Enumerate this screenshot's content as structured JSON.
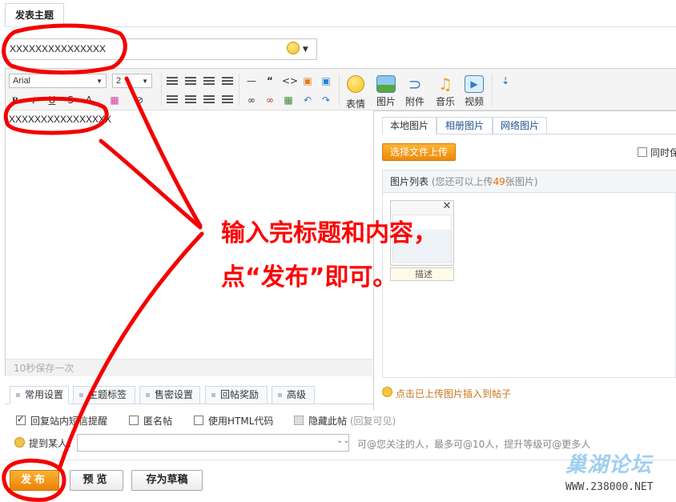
{
  "header": {
    "tab_label": "发表主题"
  },
  "subject": {
    "value": "XXXXXXXXXXXXXXX"
  },
  "toolbar": {
    "font": "Arial",
    "size": "2",
    "big_tools": [
      {
        "label": "表情",
        "icon": "smiley-icon"
      },
      {
        "label": "图片",
        "icon": "image-icon"
      },
      {
        "label": "附件",
        "icon": "paperclip-icon"
      },
      {
        "label": "音乐",
        "icon": "music-icon"
      },
      {
        "label": "视频",
        "icon": "video-icon"
      }
    ]
  },
  "editor": {
    "body": "XXXXXXXXXXXXXXXX",
    "autosave": "10秒保存一次"
  },
  "image_panel": {
    "tabs": [
      "本地图片",
      "相册图片",
      "网络图片"
    ],
    "upload_button": "选择文件上传",
    "same_label": "同时保",
    "list_title": "图片列表",
    "list_hint_prefix": "(您还可以上传",
    "list_hint_count": "49",
    "list_hint_suffix": "张图片)",
    "desc_placeholder": "描述",
    "insert_tip": "点击已上传图片插入到帖子"
  },
  "settings": {
    "tabs": [
      "常用设置",
      "主题标签",
      "售密设置",
      "回帖奖励",
      "高级"
    ],
    "options": [
      {
        "label": "回复站内短信提醒",
        "checked": true
      },
      {
        "label": "匿名帖",
        "checked": false
      },
      {
        "label": "使用HTML代码",
        "checked": false
      },
      {
        "label": "隐藏此帖",
        "note": "(回复可见)",
        "checked": false,
        "disabled": true
      }
    ],
    "mention_label": "提到某人：",
    "mention_hint": "可@您关注的人，最多可@10人，提升等级可@更多人"
  },
  "actions": {
    "publish": "发布",
    "preview": "预览",
    "draft": "存为草稿"
  },
  "annotation": {
    "line1": "输入完标题和内容，",
    "line2": "点“发布”即可。"
  },
  "watermark": {
    "logo": "巢湖论坛",
    "url": "WWW.238000.NET"
  },
  "colors": {
    "accent_orange": "#ee8a0a",
    "annotation_red": "#ff0000",
    "link_blue": "#1e5494"
  }
}
